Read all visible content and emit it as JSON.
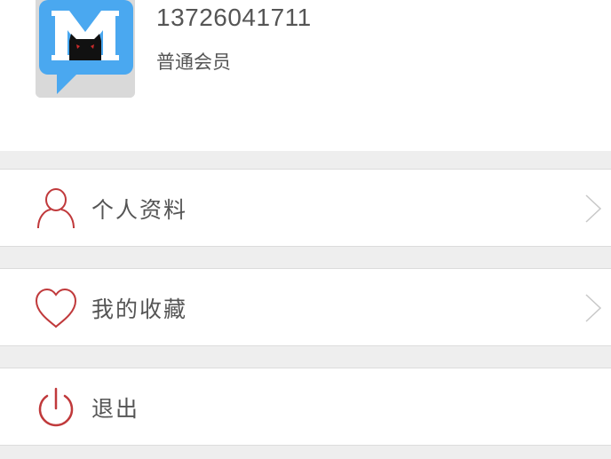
{
  "profile": {
    "username": "13726041711",
    "membership": "普通会员",
    "avatar_icon": "m-logo-chat-bubble-icon"
  },
  "menu": {
    "items": [
      {
        "label": "个人资料",
        "icon": "person-outline-icon",
        "has_chevron": true
      },
      {
        "label": "我的收藏",
        "icon": "heart-outline-icon",
        "has_chevron": true
      },
      {
        "label": "退出",
        "icon": "power-icon",
        "has_chevron": false
      }
    ]
  },
  "colors": {
    "accent": "#c0393b",
    "avatar_bubble": "#4aa8f0",
    "text": "#555555",
    "background": "#eeeeee"
  }
}
